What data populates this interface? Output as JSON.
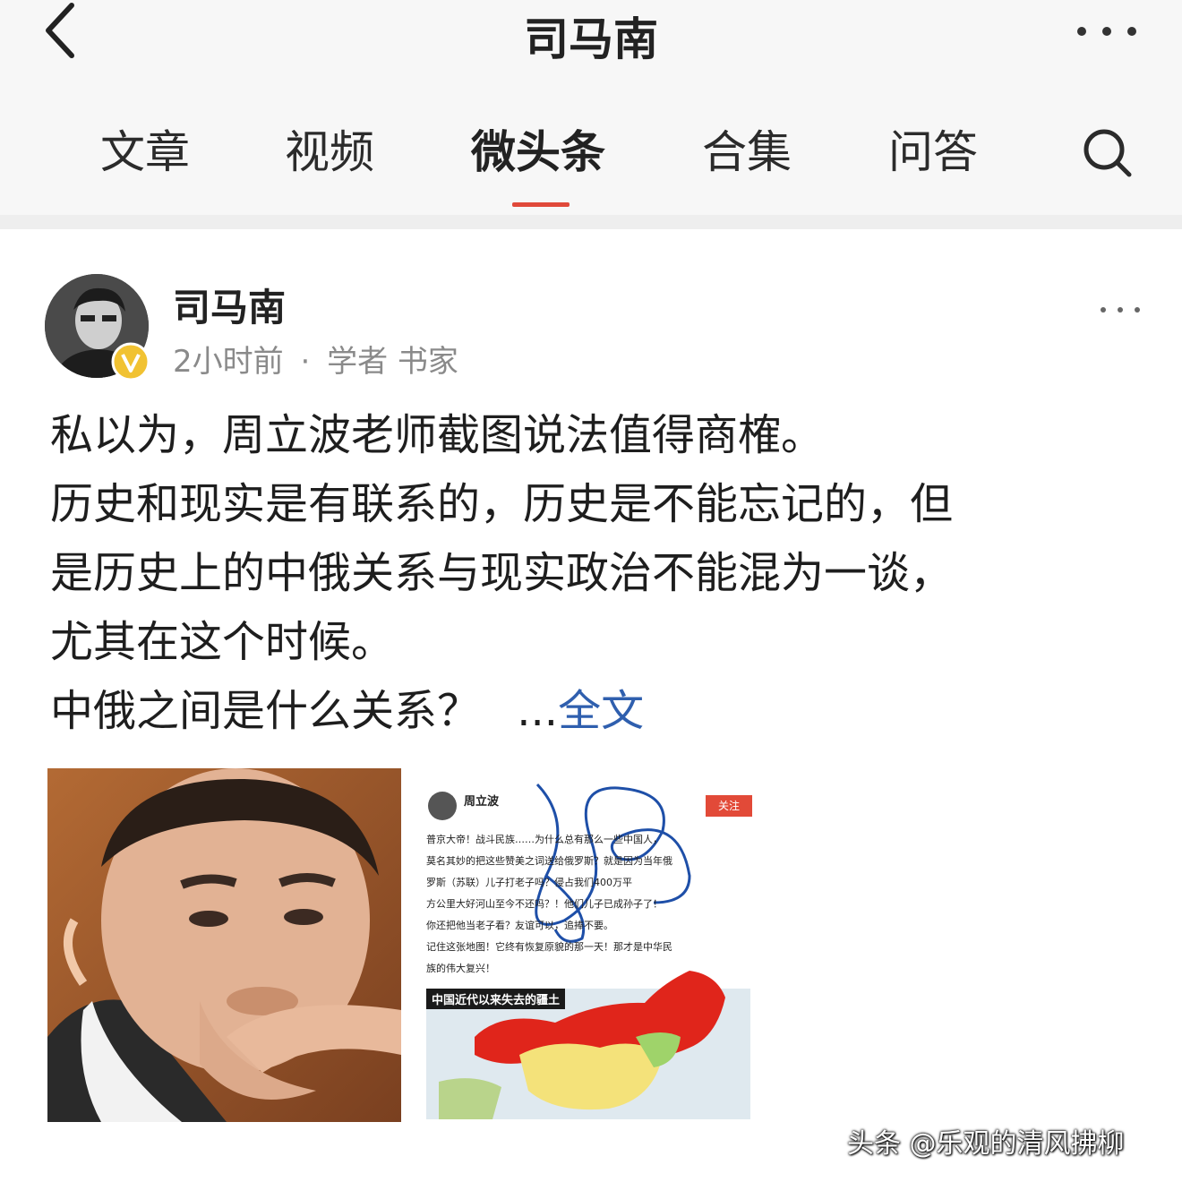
{
  "header": {
    "title": "司马南",
    "back_icon": "chevron-left-icon",
    "more_icon": "more-horizontal-icon"
  },
  "tabs": [
    {
      "label": "文章"
    },
    {
      "label": "视频"
    },
    {
      "label": "微头条",
      "active": true
    },
    {
      "label": "合集"
    },
    {
      "label": "问答"
    }
  ],
  "search_icon": "search-icon",
  "accent_color": "#e0493a",
  "post": {
    "author": "司马南",
    "time": "2小时前",
    "separator": "·",
    "role": "学者 书家",
    "lines": [
      "私以为，周立波老师截图说法值得商榷。",
      "历史和现实是有联系的，历史是不能忘记的，但",
      "是历史上的中俄关系与现实政治不能混为一谈，",
      "尤其在这个时候。",
      "中俄之间是什么关系？"
    ],
    "ellipsis": "...",
    "fulltext_label": "全文"
  },
  "screenshot_card": {
    "name": "周立波",
    "badge": "关注",
    "lines": [
      "普京大帝！战斗民族……为什么总有那么一些中国人，",
      "莫名其妙的把这些赞美之词送给俄罗斯？就是因为当年俄",
      "罗斯（苏联）儿子打老子吗？侵占我们400万平",
      "方公里大好河山至今不还吗？！他们儿子已成孙子了！",
      "你还把他当老子看？友谊可以，追捧不要。",
      "记住这张地图！它终有恢复原貌的那一天！那才是中华民",
      "族的伟大复兴！"
    ],
    "map_title": "中国近代以来失去的疆土"
  },
  "watermark": "头条 @乐观的清风拂柳"
}
